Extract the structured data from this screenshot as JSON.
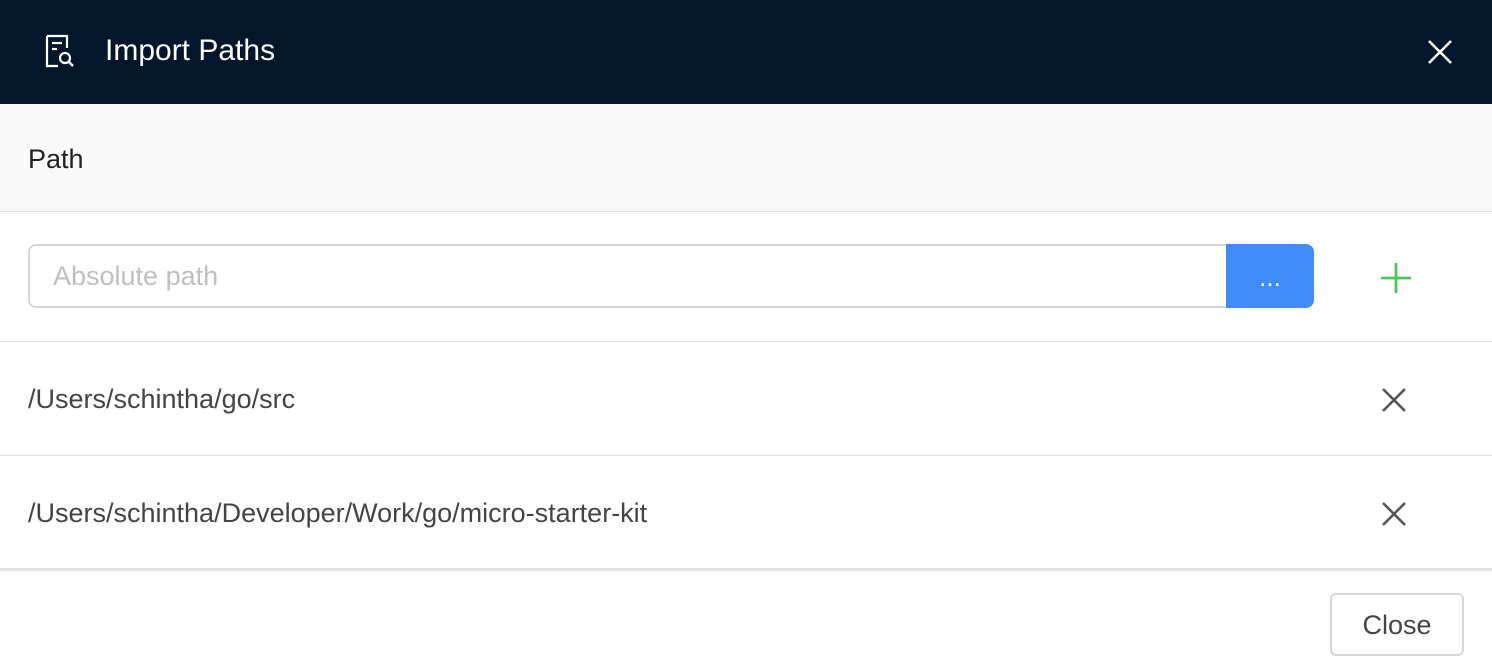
{
  "dialog": {
    "title": "Import Paths",
    "title_icon": "file-search-icon",
    "close_icon": "close-icon"
  },
  "table": {
    "column_header": "Path"
  },
  "input_row": {
    "placeholder": "Absolute path",
    "value": "",
    "browse_label": "...",
    "add_icon": "plus-icon",
    "add_color": "#4cc75a"
  },
  "paths": [
    {
      "path": "/Users/schintha/go/src",
      "remove_icon": "remove-icon"
    },
    {
      "path": "/Users/schintha/Developer/Work/go/micro-starter-kit",
      "remove_icon": "remove-icon"
    }
  ],
  "footer": {
    "close_label": "Close"
  },
  "colors": {
    "header_bg": "#04162b",
    "accent": "#418bf8",
    "add_green": "#4cc75a"
  }
}
